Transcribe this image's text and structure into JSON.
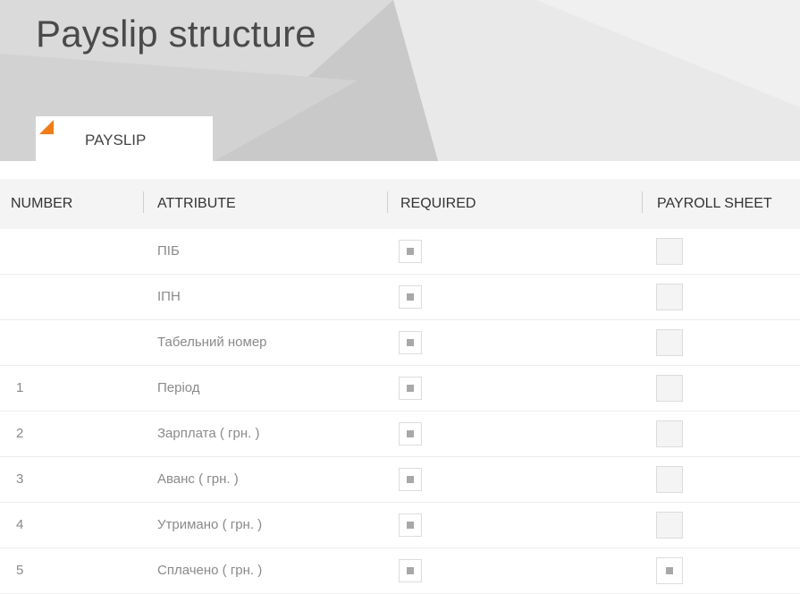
{
  "page": {
    "title": "Payslip structure",
    "tab_label": "PAYSLIP",
    "accent_color": "#f07c1a"
  },
  "table": {
    "columns": [
      "NUMBER",
      "ATTRIBUTE",
      "REQUIRED",
      "PAYROLL SHEET"
    ],
    "rows": [
      {
        "number": "",
        "attribute": "ПІБ",
        "required": true,
        "payroll_sheet": false
      },
      {
        "number": "",
        "attribute": "ІПН",
        "required": true,
        "payroll_sheet": false
      },
      {
        "number": "",
        "attribute": "Табельний номер",
        "required": true,
        "payroll_sheet": false
      },
      {
        "number": "1",
        "attribute": "Період",
        "required": true,
        "payroll_sheet": false
      },
      {
        "number": "2",
        "attribute": "Зарплата ( грн. )",
        "required": true,
        "payroll_sheet": false
      },
      {
        "number": "3",
        "attribute": "Аванс ( грн. )",
        "required": true,
        "payroll_sheet": false
      },
      {
        "number": "4",
        "attribute": "Утримано ( грн. )",
        "required": true,
        "payroll_sheet": false
      },
      {
        "number": "5",
        "attribute": "Сплачено ( грн. )",
        "required": true,
        "payroll_sheet": true
      }
    ]
  }
}
